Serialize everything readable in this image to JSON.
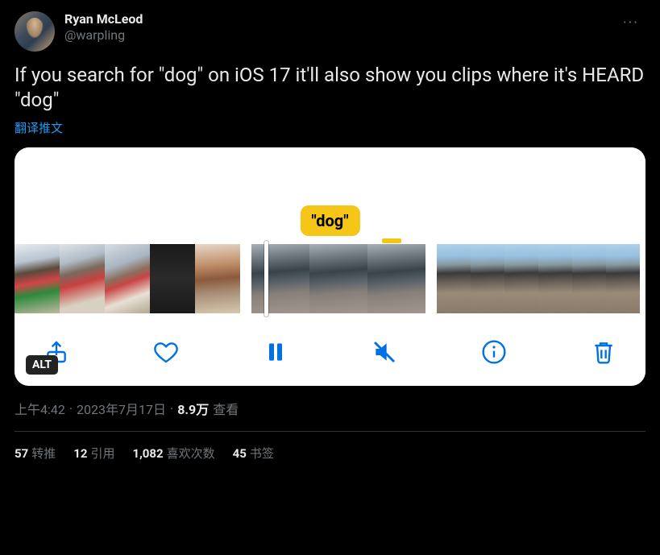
{
  "author": {
    "display_name": "Ryan McLeod",
    "handle": "@warpling"
  },
  "more_label": "···",
  "tweet_text": "If you search for \"dog\" on iOS 17 it'll also show you clips where it's HEARD \"dog\"",
  "translate_label": "翻译推文",
  "media": {
    "caption_bubble": "\"dog\"",
    "alt_badge": "ALT",
    "icons": {
      "share": "share-icon",
      "like": "heart-icon",
      "pause": "pause-icon",
      "mute": "mute-icon",
      "info": "info-icon",
      "trash": "trash-icon"
    }
  },
  "meta": {
    "time": "上午4:42",
    "dot1": "·",
    "date": "2023年7月17日",
    "dot2": "·",
    "views_count": "8.9万",
    "views_label": "查看"
  },
  "stats": {
    "retweets": {
      "count": "57",
      "label": "转推"
    },
    "quotes": {
      "count": "12",
      "label": "引用"
    },
    "likes": {
      "count": "1,082",
      "label": "喜欢次数"
    },
    "bookmarks": {
      "count": "45",
      "label": "书签"
    }
  }
}
